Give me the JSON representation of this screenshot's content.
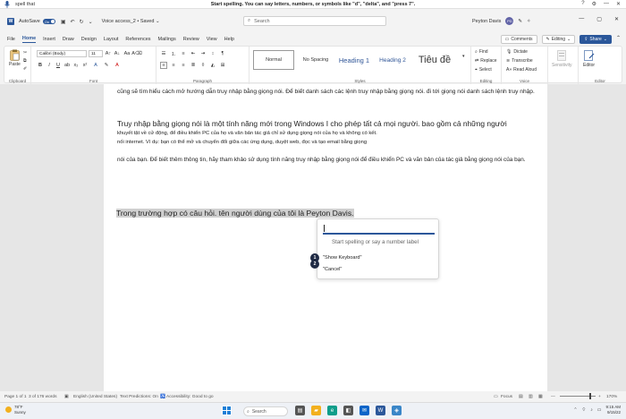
{
  "voice_bar": {
    "label": "spell that",
    "hint": "Start spelling. You can say letters, numbers, or symbols like \"d\", \"delta\", and \"press 7\".",
    "controls": [
      "?",
      "⚙",
      "—",
      "✕"
    ]
  },
  "titlebar": {
    "app_logo": "W",
    "autosave_label": "AutoSave",
    "autosave_state": "On",
    "doc_name": "Voice access_2 • Saved ⌄",
    "search_placeholder": "Search",
    "user_name": "Peyton Davis",
    "user_initials": "PD",
    "window_controls": [
      "—",
      "▢",
      "✕"
    ]
  },
  "tabs": [
    "File",
    "Home",
    "Insert",
    "Draw",
    "Design",
    "Layout",
    "References",
    "Mailings",
    "Review",
    "View",
    "Help"
  ],
  "active_tab": "Home",
  "tabs_right": {
    "comments": "Comments",
    "editing": "Editing",
    "share": "Share"
  },
  "ribbon": {
    "clipboard_label": "Clipboard",
    "paste_label": "Paste",
    "font_label": "Font",
    "font_name": "Calibri (Body)",
    "font_size": "11",
    "paragraph_label": "Paragraph",
    "styles_label": "Styles",
    "styles": [
      "Normal",
      "No Spacing",
      "Heading 1",
      "Heading 2",
      "Tiêu đề"
    ],
    "editing_label": "Editing",
    "find": "Find",
    "replace": "Replace",
    "select": "Select",
    "voice_label": "Voice",
    "dictate": "Dictate",
    "transcribe": "Transcribe",
    "read_aloud": "Read Aloud",
    "sensitivity": "Sensitivity",
    "editor_label": "Editor",
    "editor": "Editor"
  },
  "document": {
    "p1": "cũng sẽ tìm hiểu cách mở hướng dẫn truy nhập bằng giọng nói. Để biết danh sách các lệnh truy nhập bằng giọng nói. đi tới giọng nói danh sách lệnh truy nhập.",
    "p2": "Truy nhập bằng giọng nói là một tính năng mới trong Windows I cho phép tất cả mọi người. bao gồm cả những người",
    "p3_line1": "khuyết tật về cử động, để điều khiển PC của họ và văn bản tác giả chỉ sử dụng giọng nói của họ và không có kết.",
    "p3_line2": "nối internet. Ví dụ: bạn có thể mở và chuyển đổi giữa các ứng dụng, duyệt web, đọc và tạo email bằng giọng",
    "p4": "nói của bạn. Để biết thêm thông tin, hãy tham khảo sử dụng tính năng truy nhập bằng giọng nói để điều khiển PC và văn bản của tác giả bằng giọng nói của bạn.",
    "highlight": "Trong trường hợp có câu hỏi. tên người dùng của tôi là Peyton Davis."
  },
  "spell_popup": {
    "placeholder": "Start spelling or say a number label",
    "options": [
      {
        "num": "1",
        "label": "\"Show Keyboard\""
      },
      {
        "num": "2",
        "label": "\"Cancel\""
      }
    ]
  },
  "status_bar": {
    "page": "Page 1 of 1",
    "words": "3 of 176 words",
    "language": "English (United States)",
    "predictions": "Text Predictions: On",
    "accessibility": "Accessibility: Good to go",
    "focus": "Focus",
    "zoom": "170%"
  },
  "taskbar": {
    "temperature": "78°F",
    "weather": "Sunny",
    "search": "Search",
    "time": "9:15 AM",
    "date": "9/15/22"
  },
  "colors": {
    "accent": "#2b579a",
    "highlight": "#d0d0d0",
    "badge": "#1f2a44"
  }
}
